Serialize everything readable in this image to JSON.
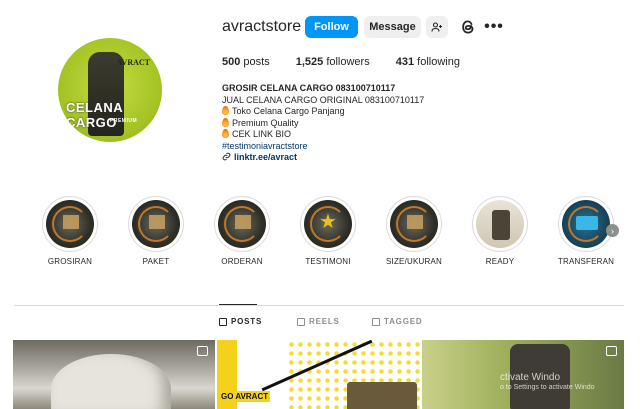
{
  "profile": {
    "username": "avractstore",
    "follow_label": "Follow",
    "message_label": "Message",
    "stats": {
      "posts_count": "500",
      "posts_label": "posts",
      "followers_count": "1,525",
      "followers_label": "followers",
      "following_count": "431",
      "following_label": "following"
    },
    "bio": {
      "name": "GROSIR CELANA CARGO 083100710117",
      "lines": [
        "JUAL CELANA CARGO ORIGINAL 083100710117",
        "Toko Celana Cargo Panjang",
        "Premium Quality",
        "CEK LINK BIO"
      ],
      "hashtag": "#testimoniavractstore",
      "link": "linktr.ee/avract"
    },
    "avatar": {
      "brand": "AVRACT",
      "headline": "CELANA CARGO",
      "subline": "PREMIUM"
    }
  },
  "highlights": [
    {
      "label": "GROSIRAN"
    },
    {
      "label": "PAKET"
    },
    {
      "label": "ORDERAN"
    },
    {
      "label": "TESTIMONI"
    },
    {
      "label": "SIZE/UKURAN"
    },
    {
      "label": "READY"
    },
    {
      "label": "TRANSFERAN"
    }
  ],
  "tabs": {
    "posts": "POSTS",
    "reels": "REELS",
    "tagged": "TAGGED"
  },
  "posts": {
    "post2_text": "GO AVRACT"
  },
  "watermark": {
    "line1": "ctivate Windo",
    "line2": "o to Settings to activate Windo"
  },
  "colors": {
    "accent": "#0095f6",
    "link": "#00376b",
    "text": "#262626",
    "muted": "#8e8e8e"
  },
  "icons": {
    "suggest": "person-plus-icon",
    "threads": "threads-icon",
    "more": "more-horizontal-icon",
    "bio_emoji": "fire-icon",
    "link": "link-icon",
    "next": "chevron-right-icon"
  }
}
